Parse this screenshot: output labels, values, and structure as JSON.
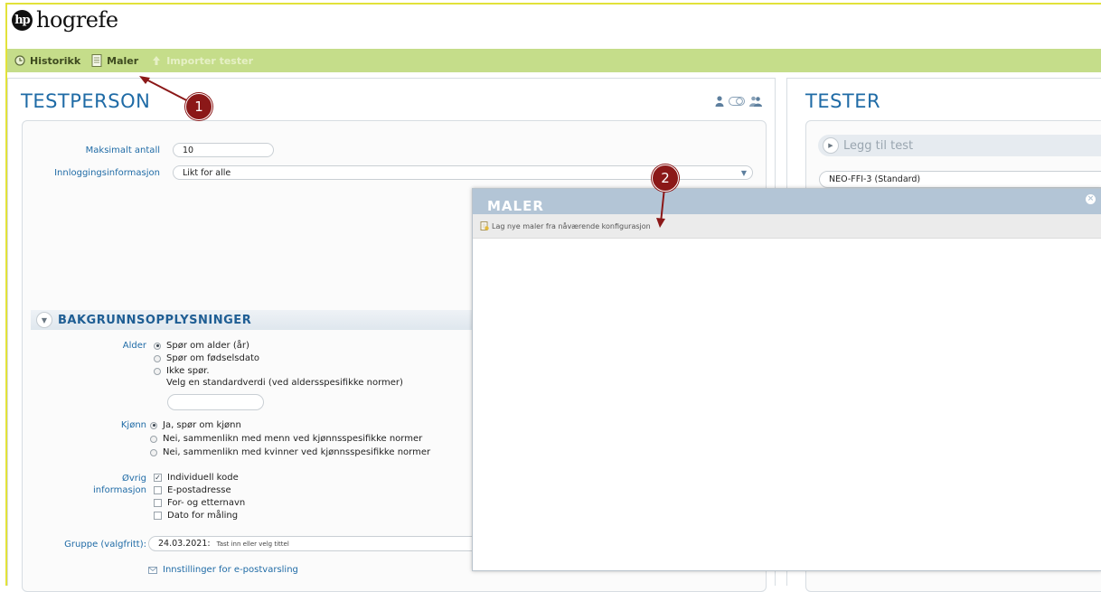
{
  "logo": {
    "mark": "hp",
    "text": "hogrefe"
  },
  "toolbar": {
    "historikk": "Historikk",
    "maler": "Maler",
    "importer": "Importer tester"
  },
  "left": {
    "title": "TESTPERSON",
    "maks_label": "Maksimalt antall",
    "maks_value": "10",
    "innlogging_label": "Innloggingsinformasjon",
    "innlogging_value": "Likt for alle",
    "section_title": "BAKGRUNNSOPPLYSNINGER",
    "alder_label": "Alder",
    "alder_options": [
      "Spør om alder (år)",
      "Spør om fødselsdato",
      "Ikke spør."
    ],
    "alder_note": "Velg en standardverdi (ved aldersspesifikke normer)",
    "kjonn_label": "Kjønn",
    "kjonn_options": [
      "Ja, spør om kjønn",
      "Nei, sammenlikn med menn ved kjønnsspesifikke normer",
      "Nei, sammenlikn med kvinner ved kjønnsspesifikke normer"
    ],
    "ovrig_label1": "Øvrig",
    "ovrig_label2": "informasjon",
    "ovrig_options": [
      "Individuell kode",
      "E-postadresse",
      "For- og etternavn",
      "Dato for måling"
    ],
    "gruppe_label": "Gruppe (valgfritt):",
    "gruppe_date": "24.03.2021:",
    "gruppe_placeholder": "Tast inn eller velg tittel",
    "email_settings": "Innstillinger for e-postvarsling"
  },
  "right": {
    "title": "TESTER",
    "add_test": "Legg til test",
    "test_item": "NEO-FFI-3 (Standard)"
  },
  "modal": {
    "title": "MALER",
    "create_link": "Lag nye maler fra nåværende konfigurasjon"
  },
  "annotations": {
    "one": "1",
    "two": "2"
  },
  "colors": {
    "toolbar": "#c5dd8a",
    "title": "#1f6ba6",
    "annotation": "#8b1818",
    "modal_header": "#b3c5d6"
  }
}
